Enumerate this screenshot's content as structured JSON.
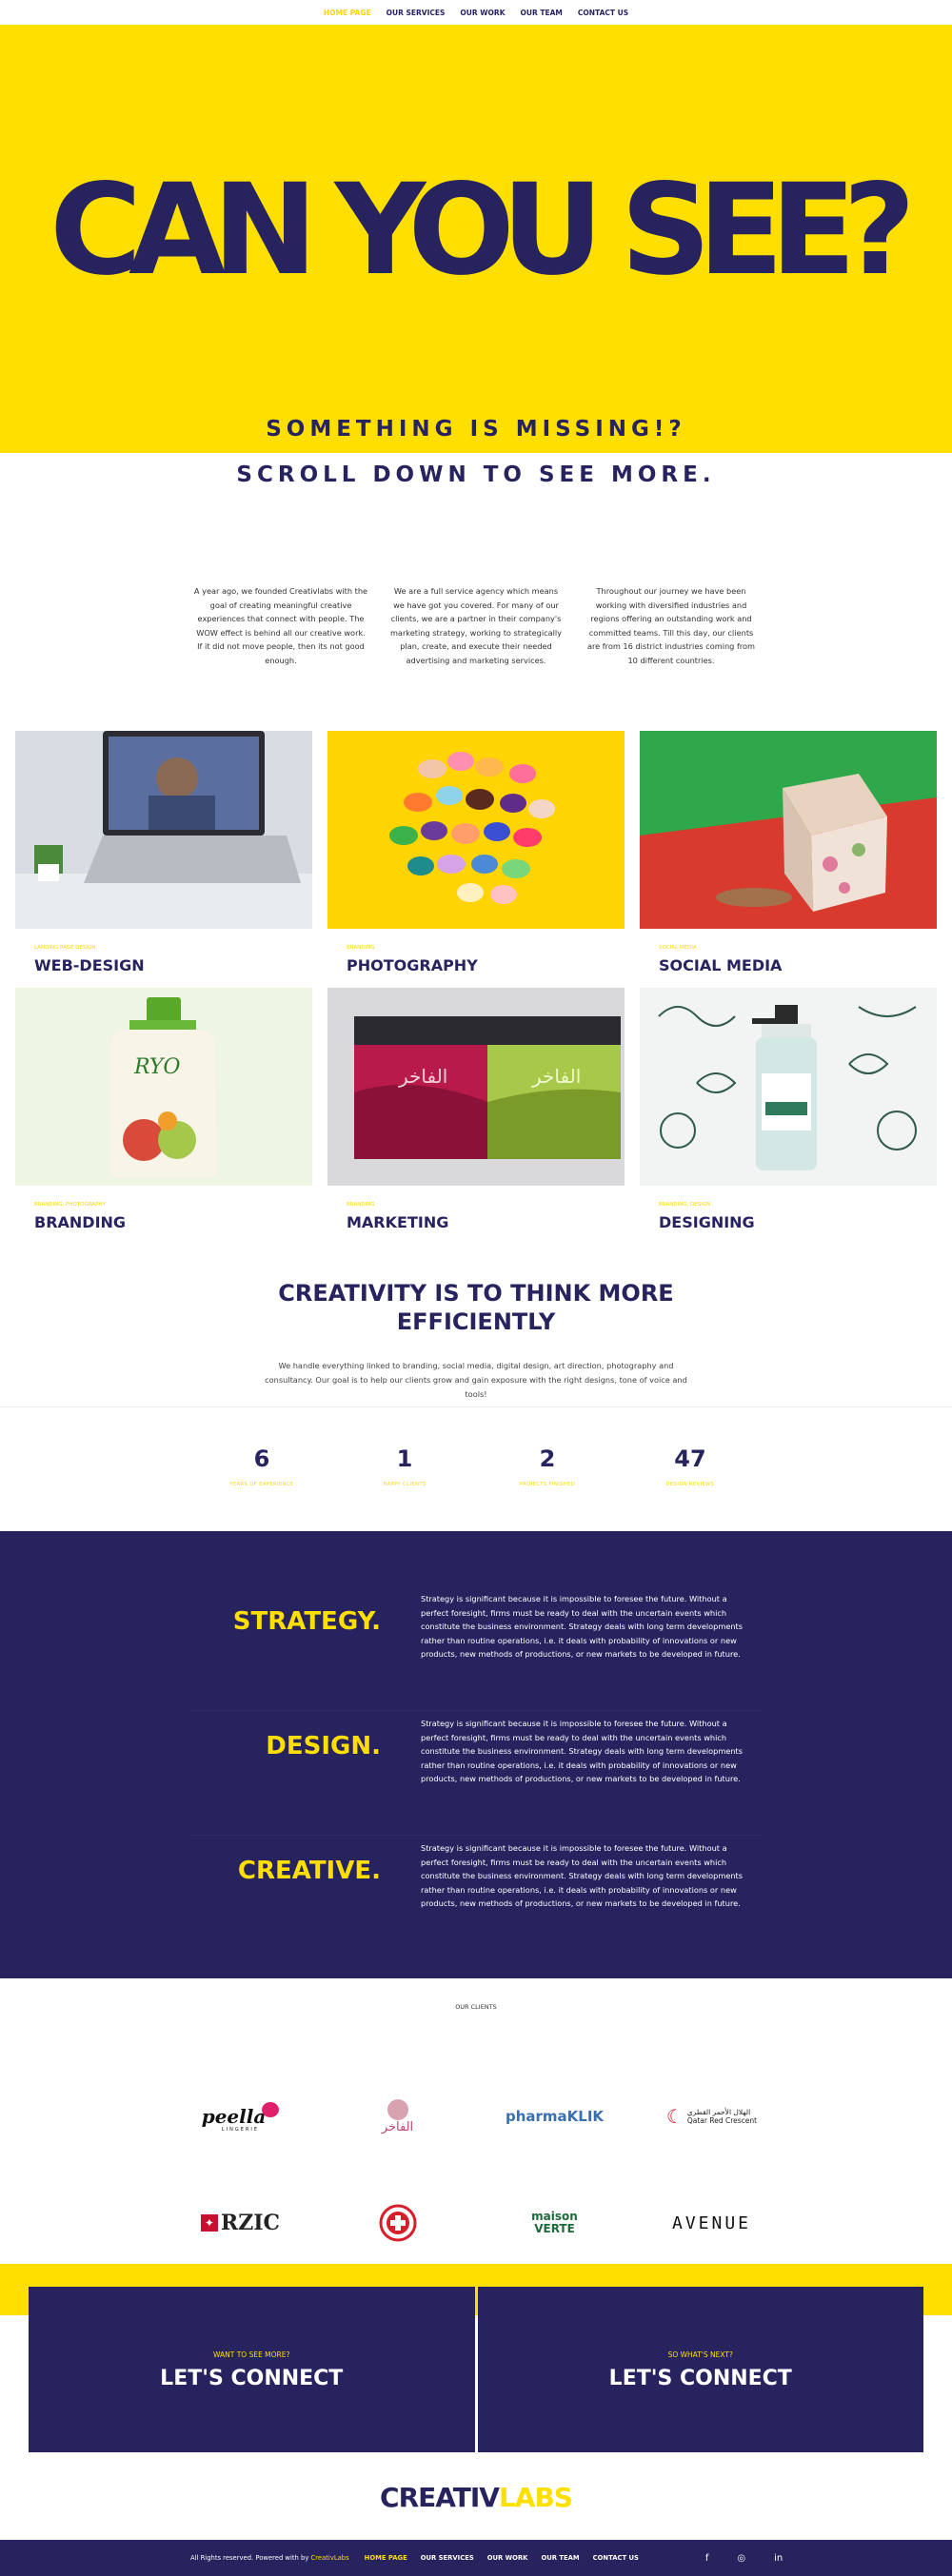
{
  "nav": {
    "items": [
      "HOME PAGE",
      "OUR SERVICES",
      "OUR WORK",
      "OUR TEAM",
      "CONTACT US"
    ],
    "active": 0
  },
  "hero": {
    "title": "CAN YOU SEE?",
    "subtitle1": "SOMETHING IS MISSING!?",
    "subtitle2": "SCROLL DOWN TO SEE MORE."
  },
  "intro": [
    "A year ago, we founded Creativlabs with the goal of creating meaningful creative experiences that connect with people. The WOW effect is behind all our creative work. If it did not move people, then its not good enough.",
    "We are a full service agency which means we have got you covered. For many of our clients, we are a partner in their company's marketing strategy, working to strategically plan, create, and execute their needed advertising and marketing services.",
    "Throughout our journey we have been working with diversified industries and regions offering an outstanding work and committed teams. Till this day, our clients are from 16 district industries coming from 10 different countries."
  ],
  "services": [
    {
      "category": "LANDING PAGE DESIGN",
      "name": "WEB-DESIGN"
    },
    {
      "category": "BRANDING",
      "name": "PHOTOGRAPHY"
    },
    {
      "category": "SOCIAL MEDIA",
      "name": "SOCIAL MEDIA"
    },
    {
      "category": "BRANDING, PHOTOGRAPHY",
      "name": "BRANDING"
    },
    {
      "category": "BRANDING",
      "name": "MARKETING"
    },
    {
      "category": "BRANDING, DESIGN",
      "name": "DESIGNING"
    }
  ],
  "creativity": {
    "title_line1": "CREATIVITY IS TO THINK MORE",
    "title_line2": "EFFICIENTLY",
    "text": "We handle everything linked to branding, social media, digital design, art direction, photography and consultancy. Our goal is to help our clients grow and gain exposure with the right designs, tone of voice and tools!"
  },
  "stats": [
    {
      "num": "6",
      "label": "YEARS OF EXPERIENCE"
    },
    {
      "num": "1",
      "label": "HAPPY CLIENTS"
    },
    {
      "num": "2",
      "label": "PROJECTS FINISHED"
    },
    {
      "num": "47",
      "label": "DESIGN REVIEWS"
    }
  ],
  "strategy": [
    {
      "heading": "STRATEGY.",
      "text": "Strategy is significant because it is impossible to foresee the future. Without a perfect foresight, firms must be ready to deal with the uncertain events which constitute the business environment. Strategy deals with long term developments rather than routine operations, i.e. it deals with probability of innovations or new products, new methods of productions, or new markets to be developed in future."
    },
    {
      "heading": "DESIGN.",
      "text": "Strategy is significant because it is impossible to foresee the future. Without a perfect foresight, firms must be ready to deal with the uncertain events which constitute the business environment. Strategy deals with long term developments rather than routine operations, i.e. it deals with probability of innovations or new products, new methods of productions, or new markets to be developed in future."
    },
    {
      "heading": "CREATIVE.",
      "text": "Strategy is significant because it is impossible to foresee the future. Without a perfect foresight, firms must be ready to deal with the uncertain events which constitute the business environment. Strategy deals with long term developments rather than routine operations, i.e. it deals with probability of innovations or new products, new methods of productions, or new markets to be developed in future."
    }
  ],
  "clients": {
    "title": "OUR CLIENTS",
    "logos": [
      {
        "text": "peella",
        "sub": "LINGERIE"
      },
      {
        "text": "الفاخر",
        "sub": ""
      },
      {
        "text": "pharmaKLIK",
        "sub": ""
      },
      {
        "text": "Qatar Red Crescent",
        "sub": "الهلال الأحمر القطري"
      },
      {
        "text": "RZIC",
        "sub": ""
      },
      {
        "text": "",
        "sub": ""
      },
      {
        "text": "maison VERTE",
        "sub": ""
      },
      {
        "text": "AVENUE",
        "sub": ""
      }
    ]
  },
  "connect": [
    {
      "question": "WANT TO SEE MORE?",
      "label": "LET'S CONNECT"
    },
    {
      "question": "SO WHAT'S NEXT?",
      "label": "LET'S CONNECT"
    }
  ],
  "footer": {
    "logo_a": "CREATIV",
    "logo_b": "LABS",
    "rights": "All Rights reserved. Powered with by",
    "powered": "CreativLabs",
    "links": [
      "HOME PAGE",
      "OUR SERVICES",
      "OUR WORK",
      "OUR TEAM",
      "CONTACT US"
    ],
    "social": [
      "f",
      "◎",
      "in"
    ]
  },
  "colors": {
    "yellow": "#ffdf00",
    "navy": "#27235f"
  }
}
